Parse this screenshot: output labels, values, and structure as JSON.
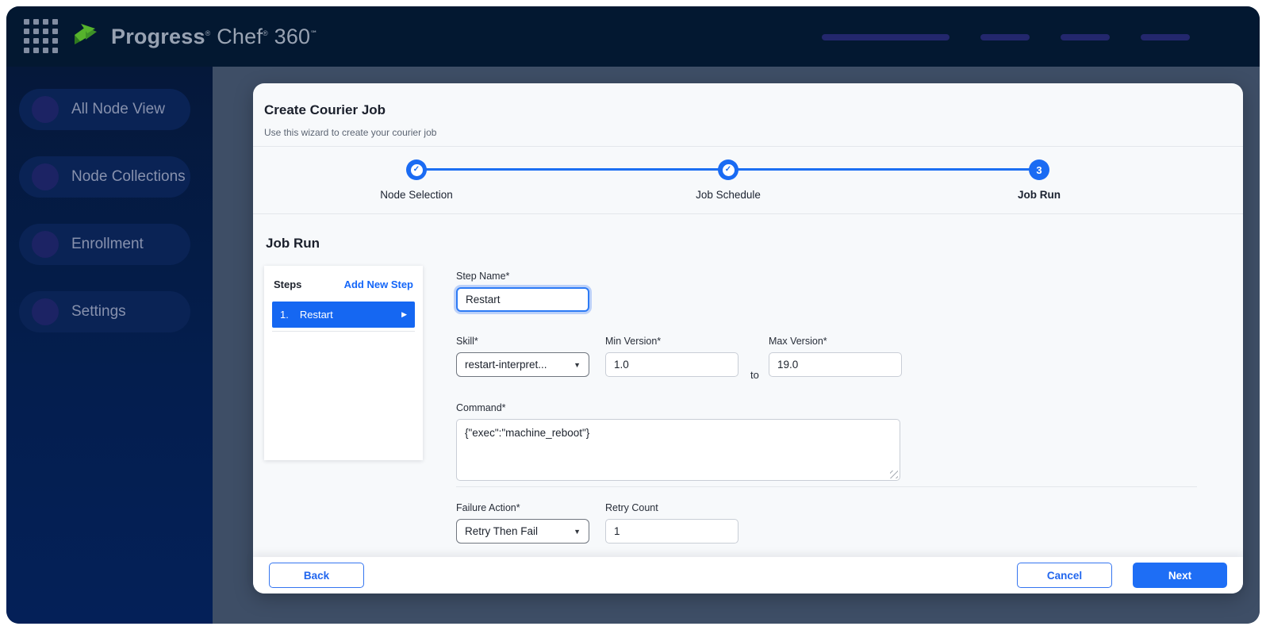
{
  "colors": {
    "topbar_bg": "#031831",
    "sidebar_bg_top": "#05183a",
    "sidebar_bg_bottom": "#042058",
    "main_bg": "#3e4e66",
    "accent_blue": "#1a6bf3",
    "logo_green": "#56b32c",
    "card_bg": "#f7f9fb"
  },
  "topbar": {
    "logo": {
      "brand": "Progress",
      "brand_reg": "®",
      "product": "Chef",
      "product_reg": "®",
      "version": "360",
      "service_mark": "℠"
    }
  },
  "sidebar": {
    "items": [
      {
        "label": "All Node View"
      },
      {
        "label": "Node Collections"
      },
      {
        "label": "Enrollment"
      },
      {
        "label": "Settings"
      }
    ]
  },
  "wizard": {
    "title": "Create Courier Job",
    "subtitle": "Use this wizard to create your courier job",
    "stepper": {
      "steps": [
        {
          "label": "Node Selection",
          "state": "completed",
          "icon": "check"
        },
        {
          "label": "Job Schedule",
          "state": "completed",
          "icon": "check"
        },
        {
          "label": "Job Run",
          "state": "active",
          "number": "3"
        }
      ]
    },
    "section_title": "Job Run",
    "steps_panel": {
      "heading": "Steps",
      "add_new_label": "Add New Step",
      "items": [
        {
          "index": "1.",
          "label": "Restart",
          "selected": true
        }
      ]
    },
    "form": {
      "step_name": {
        "label": "Step Name*",
        "value": "Restart"
      },
      "skill": {
        "label": "Skill*",
        "value": "restart-interpret..."
      },
      "min_version": {
        "label": "Min Version*",
        "value": "1.0"
      },
      "range_join_label": "to",
      "max_version": {
        "label": "Max Version*",
        "value": "19.0"
      },
      "command": {
        "label": "Command*",
        "value": "{\"exec\":\"machine_reboot\"}"
      },
      "failure_action": {
        "label": "Failure Action*",
        "value": "Retry Then Fail"
      },
      "retry_count": {
        "label": "Retry Count",
        "value": "1"
      }
    },
    "footer": {
      "back_label": "Back",
      "cancel_label": "Cancel",
      "next_label": "Next"
    }
  }
}
